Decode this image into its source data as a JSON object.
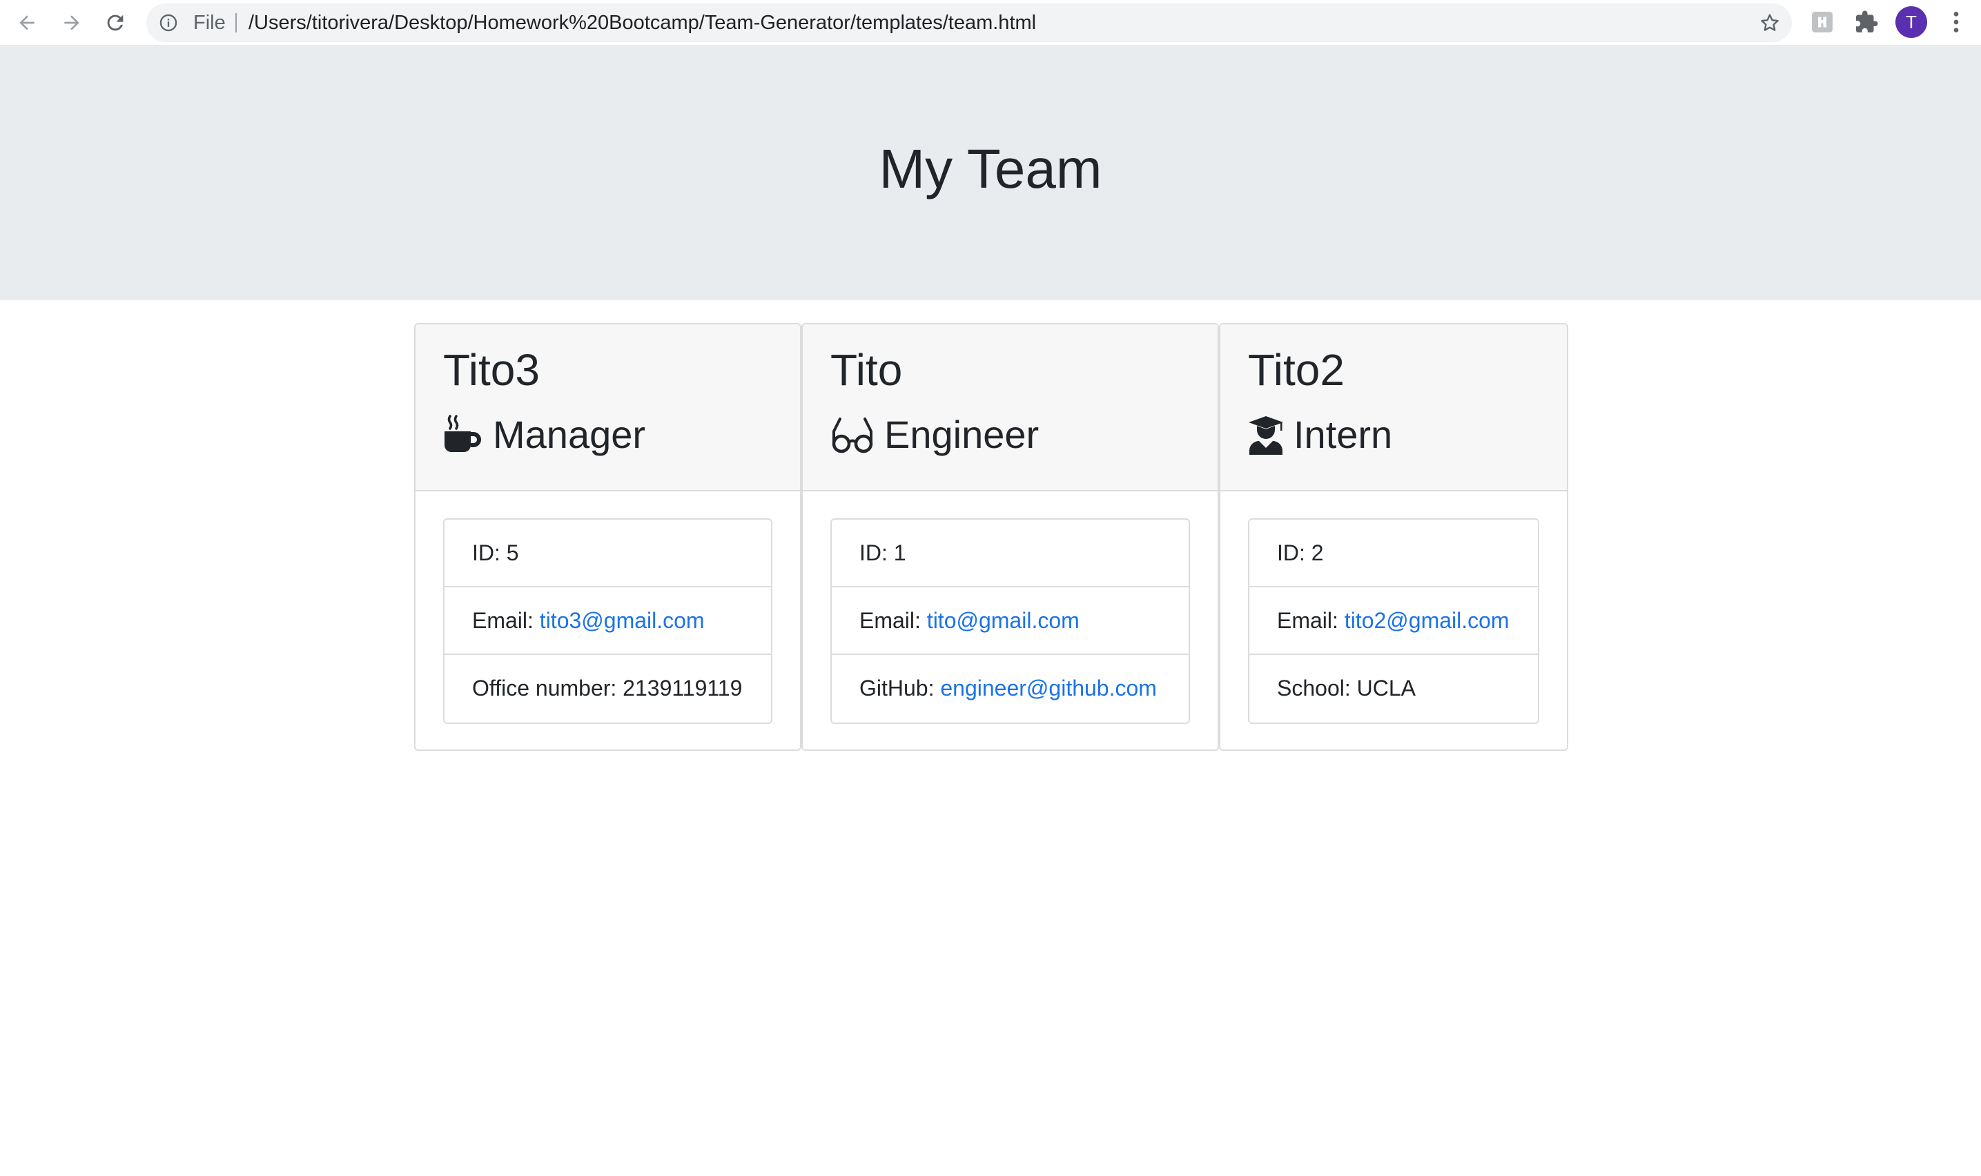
{
  "browser": {
    "url_scheme": "File",
    "url_path": "/Users/titorivera/Desktop/Homework%20Bootcamp/Team-Generator/templates/team.html",
    "profile_initial": "T",
    "profile_color": "#5a2fb0",
    "icons": [
      "back-arrow-icon",
      "forward-arrow-icon",
      "reload-icon",
      "info-icon",
      "star-icon",
      "extension-icon",
      "puzzle-icon",
      "more-vert-icon"
    ]
  },
  "page": {
    "title": "My Team"
  },
  "colors": {
    "jumbotron_bg": "#e9ecef",
    "card_header_bg": "#f7f7f7",
    "link": "#1a73e8",
    "text": "#212529"
  },
  "team": [
    {
      "name": "Tito3",
      "role": "Manager",
      "icon": "coffee-mug-icon",
      "id_label": "ID: ",
      "id": "5",
      "email_label": "Email: ",
      "email": "tito3@gmail.com",
      "extra_label": "Office number: ",
      "extra_value": "2139119119"
    },
    {
      "name": "Tito",
      "role": "Engineer",
      "icon": "glasses-icon",
      "id_label": "ID: ",
      "id": "1",
      "email_label": "Email: ",
      "email": "tito@gmail.com",
      "extra_label": "GitHub: ",
      "extra_value": "engineer@github.com"
    },
    {
      "name": "Tito2",
      "role": "Intern",
      "icon": "graduate-icon",
      "id_label": "ID: ",
      "id": "2",
      "email_label": "Email: ",
      "email": "tito2@gmail.com",
      "extra_label": "School: ",
      "extra_value": "UCLA"
    }
  ]
}
